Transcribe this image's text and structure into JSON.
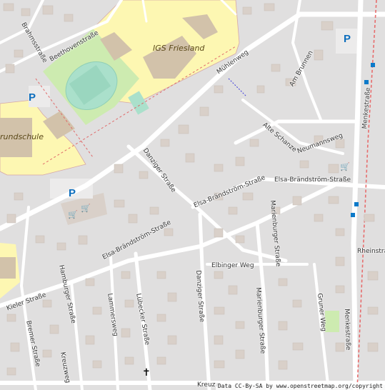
{
  "map": {
    "school_label": "IGS Friesland",
    "school_left_label": "rundschule",
    "streets": {
      "brahmsstrasse": "Brahmsstraße",
      "beethovenstrasse": "Beethovenstraße",
      "muehlenweg": "Mühlenweg",
      "am_brunnen": "Am Brunnen",
      "alte_schanze": "Alte Schanze",
      "neumannsweg": "Neumannsweg",
      "menkestrasse_top": "Menkestraße",
      "menkestrasse_bottom": "Menkestraße",
      "danziger_strasse": "Danziger Straße",
      "danziger_strasse_south": "Danziger Straße",
      "elsa_1": "Elsa-Brändström-Straße",
      "elsa_2": "Elsa-Brändström-Straße",
      "elsa_3": "Elsa-Brändström-Straße",
      "marienburger_1": "Marienburger Straße",
      "marienburger_2": "Marienburger Straße",
      "elbinger_weg": "Elbinger Weg",
      "rheinstrasse": "Rheinstra",
      "kieler_strasse": "Kieler Straße",
      "hamburger_strasse": "Hamburger Straße",
      "lammersweg": "Lammersweg",
      "luebecker_strasse": "Lübecker Straße",
      "bremer_strasse": "Bremer Straße",
      "kreuzweg_vertical": "Kreuzweg",
      "kreuzweg_bottom": "Kreuzw",
      "gruner_weg": "Gruner Weg"
    },
    "icons": {
      "parking": "P",
      "shop": "🛒",
      "church": "✝"
    },
    "attribution": "Data CC-By-SA by www.openstreetmap.org/copyright",
    "colors": {
      "background": "#e0dfdf",
      "school_area": "#fdf7b2",
      "pitch": "#aae0cb",
      "park": "#cdebb0",
      "building": "#d9d0c9",
      "road": "#ffffff",
      "rail": "#e76c6c",
      "parking_blue": "#0d6ebd",
      "shop_purple": "#b02aa8"
    }
  }
}
